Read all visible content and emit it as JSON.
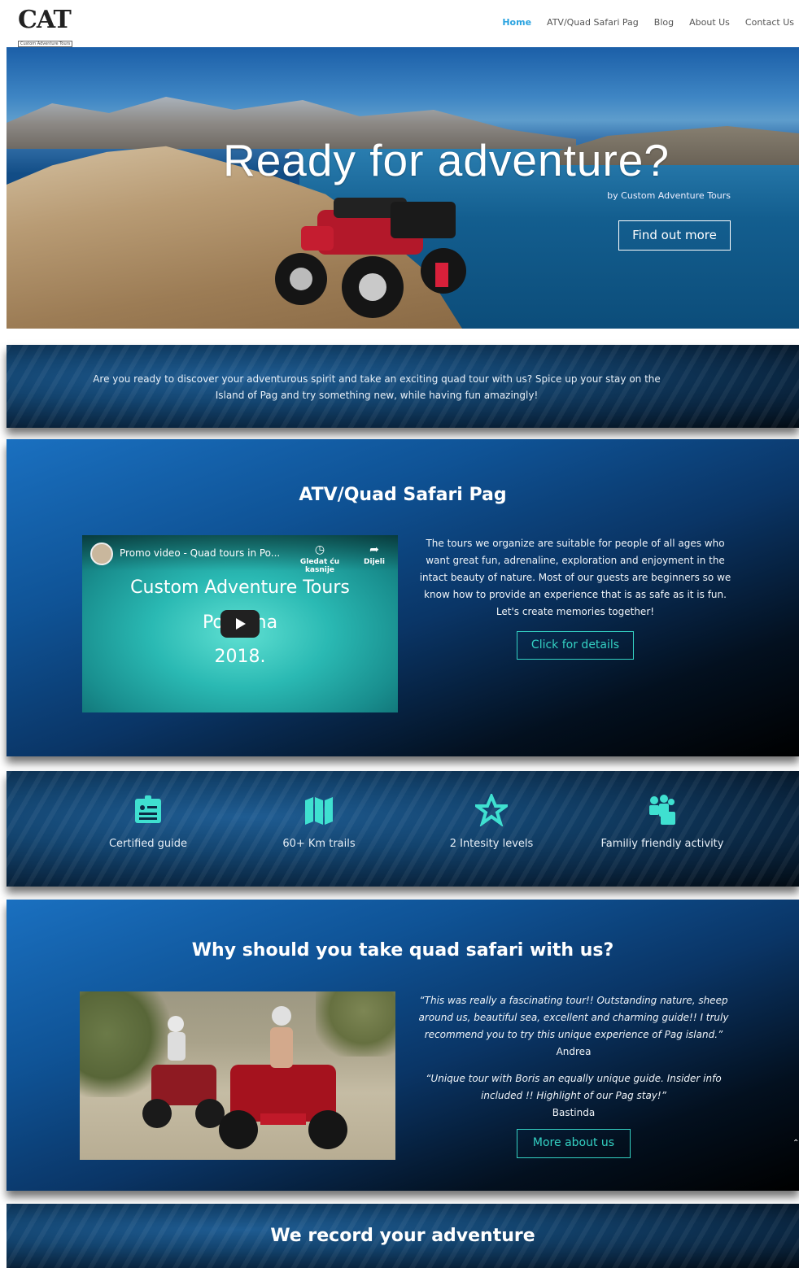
{
  "header": {
    "logo_text": "CAT",
    "logo_sub": "Custom Adventure Tours",
    "nav": [
      {
        "label": "Home",
        "active": true
      },
      {
        "label": "ATV/Quad Safari Pag",
        "active": false
      },
      {
        "label": "Blog",
        "active": false
      },
      {
        "label": "About Us",
        "active": false
      },
      {
        "label": "Contact Us",
        "active": false
      }
    ]
  },
  "hero": {
    "title": "Ready for adventure?",
    "byline": "by Custom Adventure Tours",
    "button": "Find out more"
  },
  "intro": {
    "text": "Are you ready to discover your adventurous spirit and take an exciting quad tour with us? Spice up your stay on the Island of Pag and try something new, while having fun amazingly!"
  },
  "atv_section": {
    "title": "ATV/Quad Safari Pag",
    "video": {
      "title": "Promo video - Quad tours in Po...",
      "watch_later": "Gledat ću kasnije",
      "share": "Dijeli",
      "line1": "Custom Adventure Tours",
      "line2": "Povljana",
      "line3": "2018."
    },
    "description": "The tours we organize are suitable for people of all ages who want great fun, adrenaline, exploration and enjoyment in the intact beauty of nature. Most of our guests are beginners so we know how to provide an experience that is as safe as it is fun. Let's create memories together!",
    "button": "Click for details"
  },
  "features": [
    {
      "icon": "id-card-icon",
      "label": "Certified guide"
    },
    {
      "icon": "map-icon",
      "label": "60+ Km trails"
    },
    {
      "icon": "star-icon",
      "label": "2 Intesity levels"
    },
    {
      "icon": "family-icon",
      "label": "Familiy friendly activity"
    }
  ],
  "why_section": {
    "title": "Why should you take quad safari with us?",
    "testimonials": [
      {
        "quote": "“This was really a fascinating tour!! Outstanding nature, sheep around us, beautiful sea, excellent and charming guide!! I truly recommend you to try this unique experience of Pag island.”",
        "author": "Andrea"
      },
      {
        "quote": "“Unique tour with Boris an equally unique guide. Insider info included !! Highlight of our Pag stay!”",
        "author": "Bastinda"
      }
    ],
    "button": "More about us"
  },
  "record_section": {
    "title": "We record your adventure"
  },
  "colors": {
    "accent_teal": "#34d1c3",
    "nav_active": "#2aa3e0"
  }
}
